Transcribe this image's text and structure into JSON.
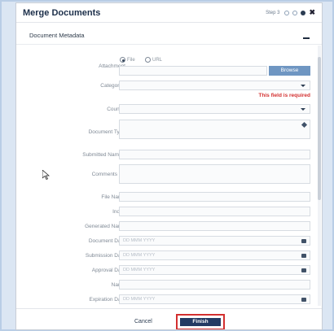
{
  "dialog": {
    "title": "Merge Documents",
    "step_label": "Step 3",
    "close_icon": "close-icon"
  },
  "section": {
    "label": "Document Metadata",
    "collapse_icon": "minus-icon"
  },
  "fields": {
    "attachment": {
      "label": "Attachment",
      "option_file": "File",
      "option_url": "URL",
      "selected": "File",
      "browse_label": "Browse"
    },
    "category": {
      "label": "Category",
      "required_mark": "*",
      "error": "This field is required"
    },
    "country": {
      "label": "Country"
    },
    "document_type": {
      "label": "Document Type"
    },
    "submitted_name": {
      "label": "Submitted Name",
      "required_mark": "*"
    },
    "comments": {
      "label": "Comments",
      "info_icon": "info-icon"
    },
    "file_name": {
      "label": "File Name"
    },
    "index": {
      "label": "Index"
    },
    "generated_name": {
      "label": "Generated Name"
    },
    "document_date": {
      "label": "Document Date",
      "placeholder": "DD MMM YYYY"
    },
    "submission_date": {
      "label": "Submission Date",
      "placeholder": "DD MMM YYYY"
    },
    "approval_date": {
      "label": "Approval Date",
      "placeholder": "DD MMM YYYY"
    },
    "name": {
      "label": "Name"
    },
    "expiration_date": {
      "label": "Expiration Date",
      "placeholder": "DD MMM YYYY"
    }
  },
  "footer": {
    "cancel_label": "Cancel",
    "finish_label": "Finish"
  },
  "colors": {
    "primary": "#233a63",
    "error": "#d32f2f",
    "browse": "#6f96c2"
  }
}
